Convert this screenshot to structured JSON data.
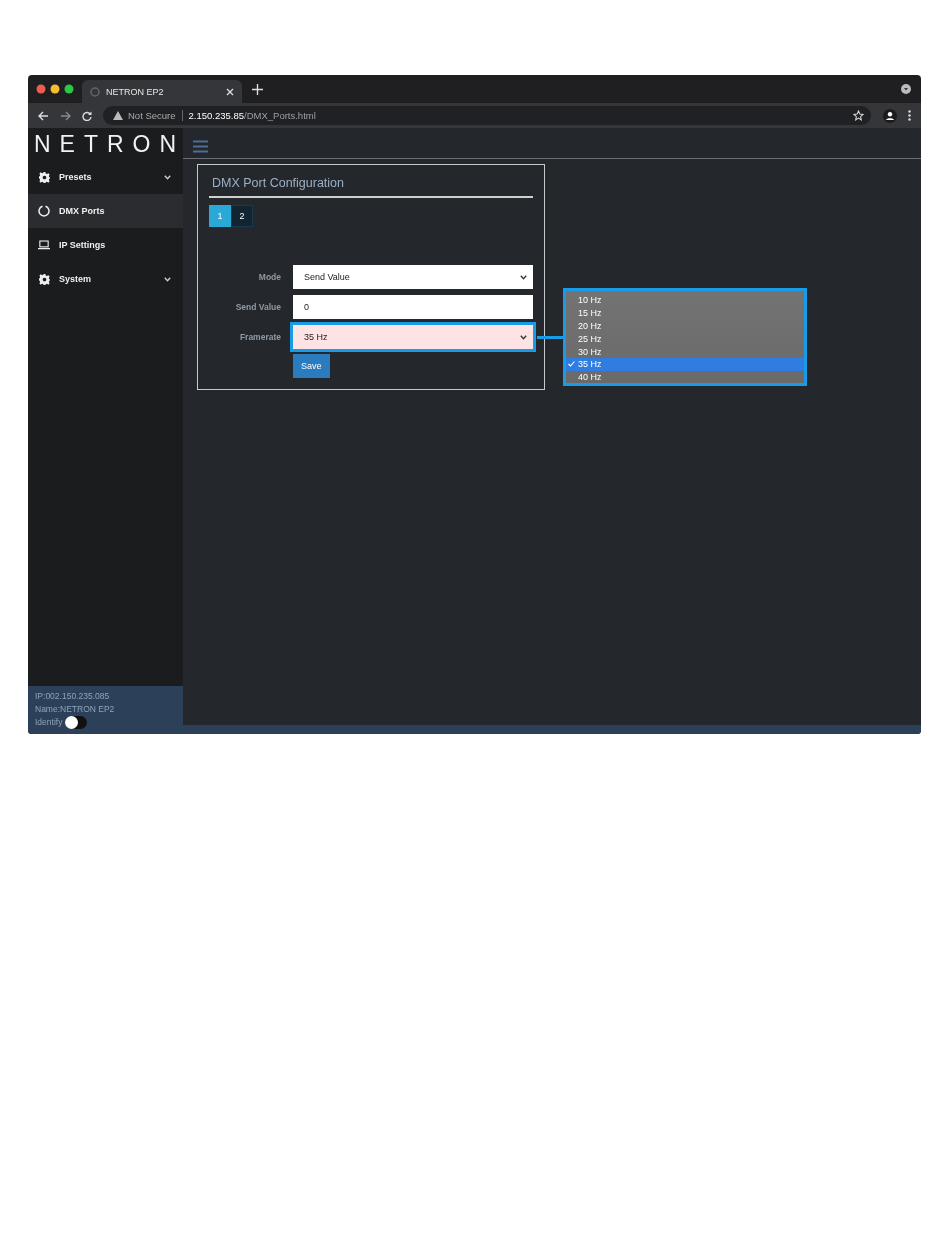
{
  "browser": {
    "tab_title": "NETRON EP2",
    "security": "Not Secure",
    "url_host": "2.150.235.85",
    "url_path": "/DMX_Ports.html"
  },
  "logo": "NETRON",
  "sidebar": {
    "items": [
      {
        "label": "Presets",
        "kind": "gear",
        "expandable": true,
        "selected": false
      },
      {
        "label": "DMX Ports",
        "kind": "ring",
        "expandable": false,
        "selected": true
      },
      {
        "label": "IP Settings",
        "kind": "laptop",
        "expandable": false,
        "selected": false
      },
      {
        "label": "System",
        "kind": "gear",
        "expandable": true,
        "selected": false
      }
    ]
  },
  "status": {
    "ip": "IP:002.150.235.085",
    "name": "Name:NETRON EP2",
    "identify_label": "Identify",
    "identify_on": false
  },
  "card": {
    "title": "DMX Port Configuration",
    "ports": [
      {
        "label": "1",
        "selected": true
      },
      {
        "label": "2",
        "selected": false
      }
    ],
    "fields": [
      {
        "kind": "select",
        "label": "Mode",
        "value": "Send Value",
        "highlighted": false
      },
      {
        "kind": "input",
        "label": "Send Value",
        "value": "0",
        "highlighted": false
      },
      {
        "kind": "select",
        "label": "Framerate",
        "value": "35 Hz",
        "highlighted": true
      }
    ],
    "save": "Save"
  },
  "dropdown": {
    "options": [
      {
        "label": "10 Hz",
        "selected": false
      },
      {
        "label": "15 Hz",
        "selected": false
      },
      {
        "label": "20 Hz",
        "selected": false
      },
      {
        "label": "25 Hz",
        "selected": false
      },
      {
        "label": "30 Hz",
        "selected": false
      },
      {
        "label": "35 Hz",
        "selected": true
      },
      {
        "label": "40 Hz",
        "selected": false
      }
    ]
  }
}
